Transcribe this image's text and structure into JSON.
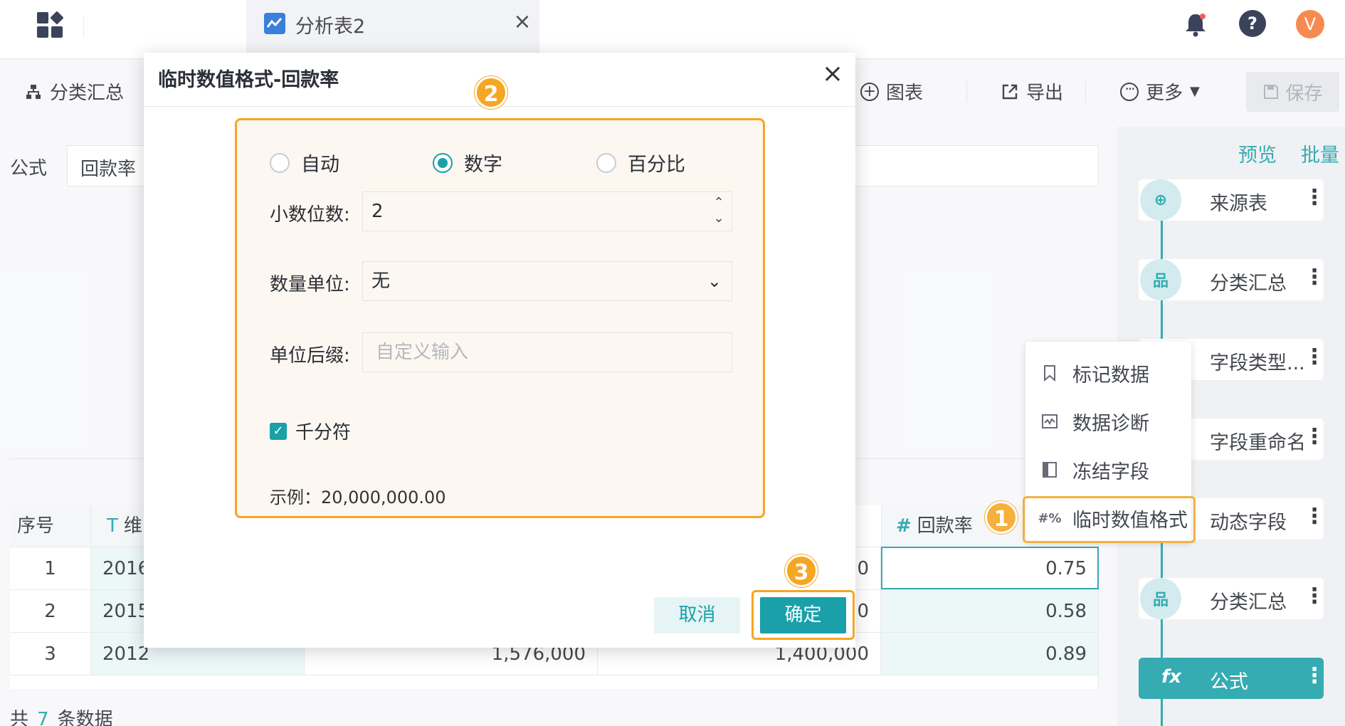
{
  "topbar": {
    "tab_title": "分析表2",
    "tab_close": "×",
    "help": "?",
    "avatar": "V"
  },
  "toolbar": {
    "group_summary": "分类汇总",
    "chart": "图表",
    "export": "导出",
    "more": "更多",
    "save": "保存"
  },
  "formula": {
    "label": "公式",
    "value": "回款率"
  },
  "table": {
    "headers": [
      "序号",
      "维",
      "回款率"
    ],
    "rows": [
      {
        "idx": "1",
        "dim": "2016",
        "c2": "",
        "c3": "0",
        "rate": "0.75"
      },
      {
        "idx": "2",
        "dim": "2015",
        "c2": "",
        "c3": "0",
        "rate": "0.58"
      },
      {
        "idx": "3",
        "dim": "2012",
        "c2": "1,576,000",
        "c3": "1,400,000",
        "rate": "0.89"
      }
    ]
  },
  "footer": {
    "prefix": "共",
    "count": "7",
    "suffix": "条数据"
  },
  "right_panel": {
    "preview": "预览",
    "batch": "批量",
    "steps": [
      {
        "label": "来源表"
      },
      {
        "label": "分类汇总"
      },
      {
        "label": "字段类型..."
      },
      {
        "label": "字段重命名"
      },
      {
        "label": "动态字段"
      },
      {
        "label": "分类汇总"
      },
      {
        "label": "公式"
      }
    ],
    "more_icon": "⋮"
  },
  "context_menu": {
    "items": [
      {
        "label": "标记数据",
        "icon": "bookmark-icon"
      },
      {
        "label": "数据诊断",
        "icon": "diagnose-icon"
      },
      {
        "label": "冻结字段",
        "icon": "freeze-icon"
      },
      {
        "label": "临时数值格式",
        "icon": "number-format-icon"
      }
    ]
  },
  "modal": {
    "title": "临时数值格式-回款率",
    "close": "×",
    "radio_options": [
      {
        "label": "自动",
        "checked": false
      },
      {
        "label": "数字",
        "checked": true
      },
      {
        "label": "百分比",
        "checked": false
      }
    ],
    "decimal_label": "小数位数:",
    "decimal_value": "2",
    "unit_label": "数量单位:",
    "unit_value": "无",
    "suffix_label": "单位后缀:",
    "suffix_placeholder": "自定义输入",
    "thousands_label": "千分符",
    "thousands_checked": true,
    "example": "示例：20,000,000.00",
    "cancel": "取消",
    "ok": "确定"
  },
  "badges": {
    "one": "1",
    "two": "2",
    "three": "3"
  },
  "colors": {
    "accent": "#1aa0a8",
    "highlight": "#f5a623"
  }
}
